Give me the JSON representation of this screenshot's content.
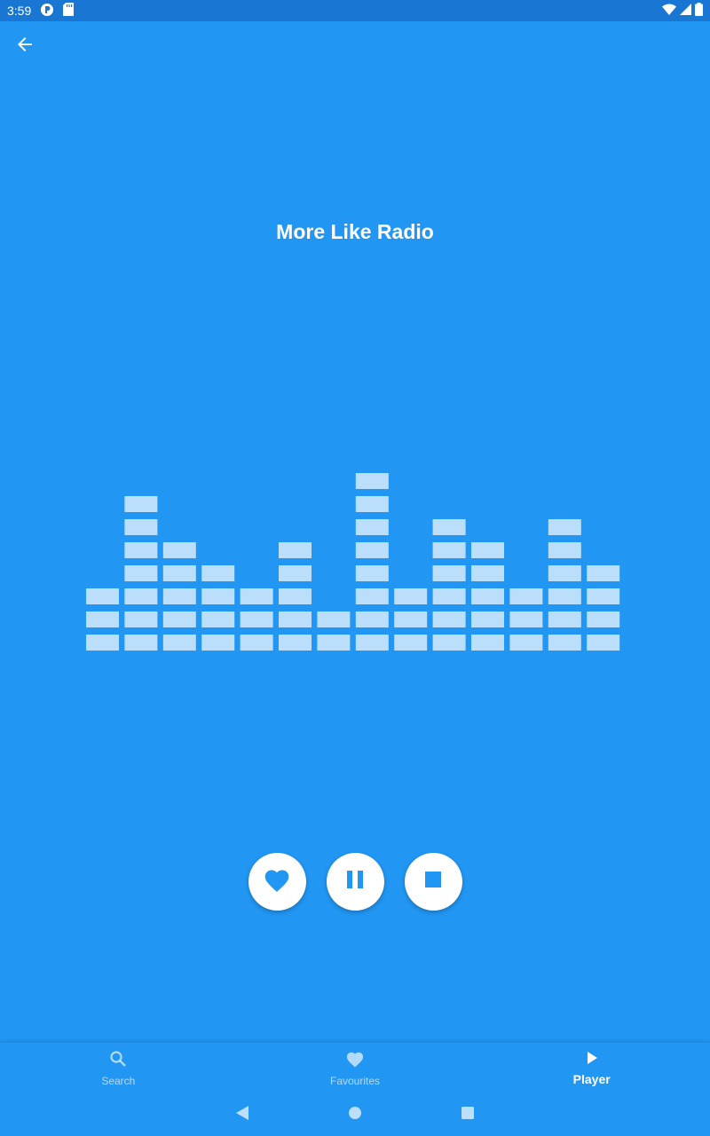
{
  "status_bar": {
    "time": "3:59",
    "icons": [
      "app-notification-icon",
      "sd-card-icon",
      "wifi-icon",
      "cell-signal-icon",
      "battery-icon"
    ]
  },
  "header": {
    "back_icon": "arrow-back-icon"
  },
  "player": {
    "station_title": "More Like Radio"
  },
  "visualizer": {
    "bar_levels": [
      3,
      7,
      5,
      4,
      3,
      5,
      2,
      8,
      3,
      6,
      5,
      3,
      6,
      4
    ],
    "max_level": 8,
    "segment_color": "#BBDEFB"
  },
  "controls": {
    "buttons": [
      {
        "name": "favourite",
        "icon": "heart-icon"
      },
      {
        "name": "pause",
        "icon": "pause-icon"
      },
      {
        "name": "stop",
        "icon": "stop-icon"
      }
    ],
    "icon_color": "#2196F3"
  },
  "bottom_nav": {
    "items": [
      {
        "label": "Search",
        "icon": "search-icon",
        "active": false
      },
      {
        "label": "Favourites",
        "icon": "heart-icon",
        "active": false
      },
      {
        "label": "Player",
        "icon": "play-icon",
        "active": true
      }
    ]
  },
  "system_nav": {
    "icons": [
      "back-triangle-icon",
      "home-circle-icon",
      "recents-square-icon"
    ]
  },
  "colors": {
    "primary": "#2196F3",
    "status_bar": "#1976D2",
    "on_primary": "#FFFFFF"
  }
}
